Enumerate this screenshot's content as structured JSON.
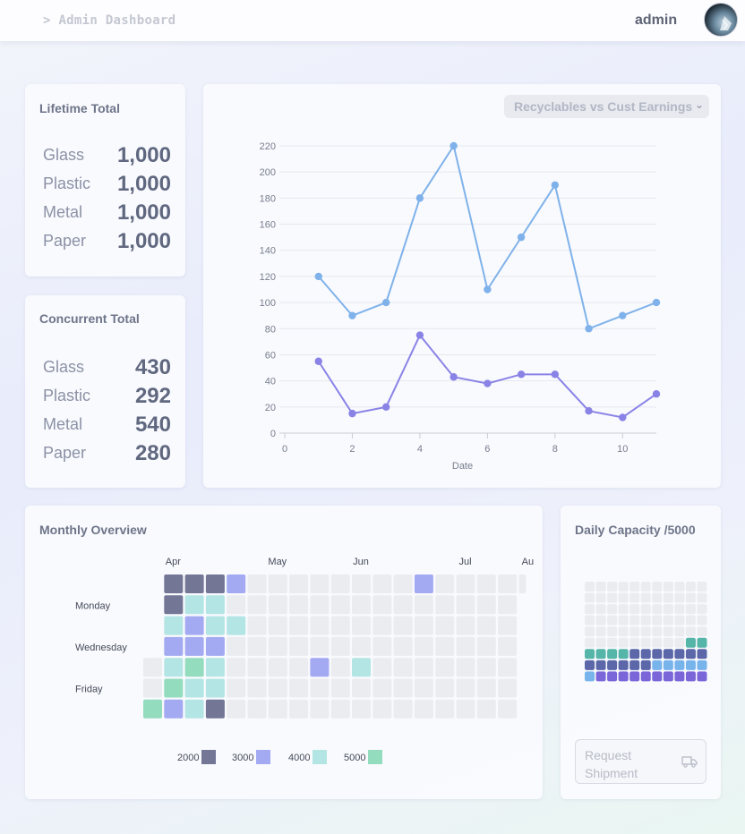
{
  "header": {
    "breadcrumb": "> Admin Dashboard",
    "username": "admin",
    "avatar_icon": "user-avatar"
  },
  "lifetime": {
    "title": "Lifetime Total",
    "items": [
      {
        "label": "Glass",
        "value": "1,000"
      },
      {
        "label": "Plastic",
        "value": "1,000"
      },
      {
        "label": "Metal",
        "value": "1,000"
      },
      {
        "label": "Paper",
        "value": "1,000"
      }
    ]
  },
  "concurrent": {
    "title": "Concurrent Total",
    "items": [
      {
        "label": "Glass",
        "value": "430"
      },
      {
        "label": "Plastic",
        "value": "292"
      },
      {
        "label": "Metal",
        "value": "540"
      },
      {
        "label": "Paper",
        "value": "280"
      }
    ]
  },
  "chart_select": {
    "selected": "Recyclables vs Cust Earnings"
  },
  "chart_data": [
    {
      "type": "line",
      "title": "",
      "xlabel": "Date",
      "ylabel": "",
      "xlim": [
        0,
        11
      ],
      "ylim": [
        0,
        220
      ],
      "x_ticks": [
        0,
        2,
        4,
        6,
        8,
        10
      ],
      "y_ticks": [
        0,
        20,
        40,
        60,
        80,
        100,
        120,
        140,
        160,
        180,
        200,
        220
      ],
      "grid": true,
      "legend": "none",
      "colors": [
        "#7fb2ea",
        "#8a83e6"
      ],
      "series": [
        {
          "x": [
            1,
            2,
            3,
            4,
            5,
            6,
            7,
            8,
            9,
            10,
            11
          ],
          "values": [
            120,
            90,
            100,
            180,
            220,
            110,
            150,
            190,
            80,
            90,
            100
          ]
        },
        {
          "x": [
            1,
            2,
            3,
            4,
            5,
            6,
            7,
            8,
            9,
            10,
            11
          ],
          "values": [
            55,
            15,
            20,
            75,
            43,
            38,
            45,
            45,
            17,
            12,
            30
          ]
        }
      ]
    },
    {
      "type": "heatmap",
      "title": "Monthly Overview",
      "months": [
        "Apr",
        "May",
        "Jun",
        "Jul",
        "Au"
      ],
      "month_col": [
        1,
        6,
        10,
        15,
        18
      ],
      "day_labels": [
        {
          "row": 1,
          "label": "Monday"
        },
        {
          "row": 3,
          "label": "Wednesday"
        },
        {
          "row": 5,
          "label": "Friday"
        }
      ],
      "weeks": 18,
      "legend": [
        {
          "label": "2000",
          "color": "#737695"
        },
        {
          "label": "3000",
          "color": "#a4aaf2"
        },
        {
          "label": "4000",
          "color": "#b3e5e4"
        },
        {
          "label": "5000",
          "color": "#93dcbd"
        }
      ],
      "empty_color": "#ebecf0",
      "rows": [
        [
          null,
          2000,
          2000,
          2000,
          3000,
          0,
          0,
          0,
          0,
          0,
          0,
          0,
          0,
          3000,
          0,
          0,
          0,
          0,
          0
        ],
        [
          null,
          2000,
          4000,
          4000,
          0,
          0,
          0,
          0,
          0,
          0,
          0,
          0,
          0,
          0,
          0,
          0,
          0,
          0,
          null
        ],
        [
          null,
          4000,
          3000,
          4000,
          4000,
          0,
          0,
          0,
          0,
          0,
          0,
          0,
          0,
          0,
          0,
          0,
          0,
          0,
          null
        ],
        [
          null,
          3000,
          3000,
          3000,
          0,
          0,
          0,
          0,
          0,
          0,
          0,
          0,
          0,
          0,
          0,
          0,
          0,
          0,
          null
        ],
        [
          0,
          4000,
          5000,
          4000,
          0,
          0,
          0,
          0,
          3000,
          0,
          4000,
          0,
          0,
          0,
          0,
          0,
          0,
          0,
          null
        ],
        [
          0,
          5000,
          4000,
          4000,
          0,
          0,
          0,
          0,
          0,
          0,
          0,
          0,
          0,
          0,
          0,
          0,
          0,
          0,
          null
        ],
        [
          5000,
          3000,
          4000,
          2000,
          0,
          0,
          0,
          0,
          0,
          0,
          0,
          0,
          0,
          0,
          0,
          0,
          0,
          0,
          null
        ]
      ]
    },
    {
      "type": "heatmap",
      "title": "Daily Capacity /5000",
      "columns": 11,
      "rows": [
        [
          "e",
          "e",
          "e",
          "e",
          "e",
          "e",
          "e",
          "e",
          "e",
          "e",
          "e"
        ],
        [
          "e",
          "e",
          "e",
          "e",
          "e",
          "e",
          "e",
          "e",
          "e",
          "e",
          "e"
        ],
        [
          "e",
          "e",
          "e",
          "e",
          "e",
          "e",
          "e",
          "e",
          "e",
          "e",
          "e"
        ],
        [
          "e",
          "e",
          "e",
          "e",
          "e",
          "e",
          "e",
          "e",
          "e",
          "e",
          "e"
        ],
        [
          "e",
          "e",
          "e",
          "e",
          "e",
          "e",
          "e",
          "e",
          "e",
          "e",
          "e"
        ],
        [
          "e",
          "e",
          "e",
          "e",
          "e",
          "e",
          "e",
          "e",
          "e",
          "t",
          "t"
        ],
        [
          "t",
          "t",
          "t",
          "t",
          "n",
          "n",
          "n",
          "n",
          "n",
          "n",
          "n"
        ],
        [
          "n",
          "n",
          "n",
          "n",
          "n",
          "n",
          "b",
          "b",
          "b",
          "b",
          "b"
        ],
        [
          "b",
          "p",
          "p",
          "p",
          "p",
          "p",
          "p",
          "p",
          "p",
          "p",
          "p"
        ]
      ],
      "cell_colors": {
        "e": "#ebecf0",
        "t": "#55b5a9",
        "n": "#5b67a8",
        "b": "#78b4ec",
        "p": "#7a66d8"
      }
    }
  ],
  "daily": {
    "title": "Daily Capacity /5000",
    "button_label": "Request Shipment",
    "button_icon": "truck-icon"
  }
}
